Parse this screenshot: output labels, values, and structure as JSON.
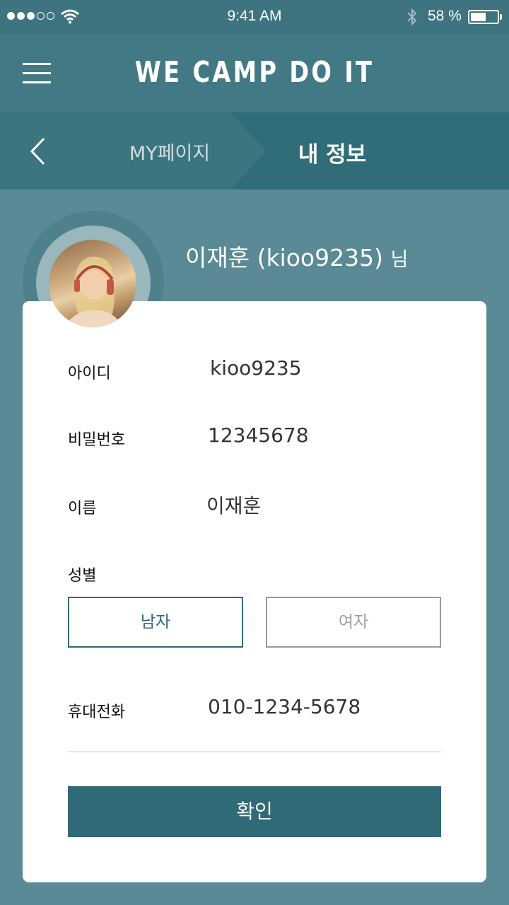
{
  "status_bar": {
    "time": "9:41 AM",
    "battery_percent": "58 %",
    "battery_level": 0.58,
    "signal_bars_filled": 3,
    "signal_bars_total": 5,
    "icons": [
      "signal-dots-icon",
      "wifi-icon",
      "bluetooth-icon",
      "battery-icon"
    ]
  },
  "header": {
    "title": "WE CAMP DO IT",
    "menu_icon": "hamburger-menu-icon"
  },
  "breadcrumb": {
    "back_icon": "chevron-left-icon",
    "parent": "MY페이지",
    "current": "내 정보"
  },
  "profile": {
    "name": "이재훈 (kioo9235)",
    "suffix": "님"
  },
  "form": {
    "id_label": "아이디",
    "id_value": "kioo9235",
    "password_label": "비밀번호",
    "password_value": "12345678",
    "name_label": "이름",
    "name_value": "이재훈",
    "gender_label": "성별",
    "gender_male": "남자",
    "gender_female": "여자",
    "gender_selected": "남자",
    "phone_label": "휴대전화",
    "phone_value": "010-1234-5678",
    "confirm": "확인"
  },
  "colors": {
    "background": "#5a8a95",
    "header": "#437985",
    "breadcrumb": "#316c79",
    "accent": "#2f6a76",
    "card": "#ffffff"
  }
}
